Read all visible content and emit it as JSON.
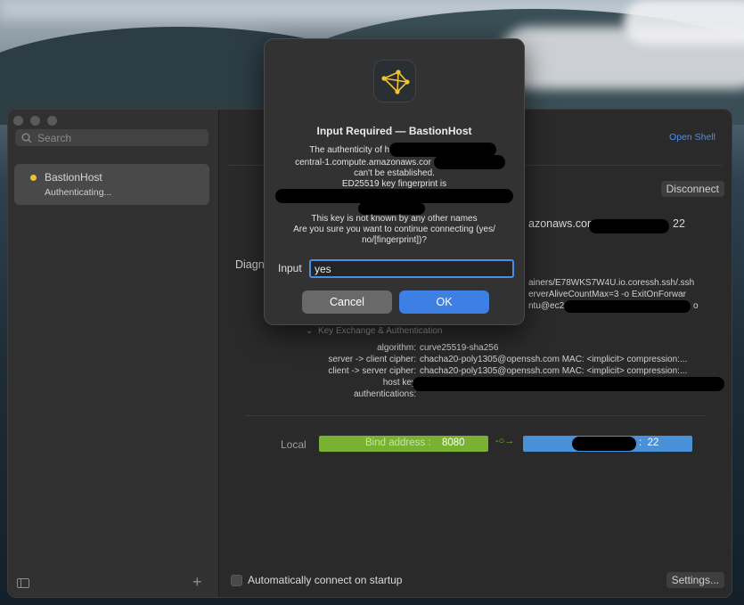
{
  "sidebar": {
    "search_placeholder": "Search",
    "host": {
      "name": "BastionHost",
      "status": "Authenticating..."
    }
  },
  "main": {
    "open_shell": "Open Shell",
    "disconnect": "Disconnect",
    "host_domain_suffix": "azonaws.com",
    "host_port": "22",
    "diagnostics_label": "Diagn",
    "command_lines": [
      "ainers/E78WKS7W4U.io.coressh.ssh/.ssh",
      "erverAliveCountMax=3 -o ExitOnForwar",
      "ntu@ec2"
    ],
    "command_tail": "o",
    "kex": {
      "heading": "Key Exchange & Authentication",
      "rows": [
        {
          "label": "algorithm:",
          "value": "curve25519-sha256"
        },
        {
          "label": "server -> client cipher:",
          "value": "chacha20-poly1305@openssh.com MAC: <implicit> compression:..."
        },
        {
          "label": "client -> server cipher:",
          "value": "chacha20-poly1305@openssh.com MAC: <implicit> compression:..."
        },
        {
          "label": "host key",
          "value": ""
        },
        {
          "label": "authentications:",
          "value": ""
        }
      ]
    },
    "forward": {
      "local_label": "Local",
      "bind_label": "Bind address",
      "bind_sep": ":",
      "bind_port": "8080",
      "dest_sep": ":",
      "dest_port": "22"
    },
    "autoconnect": "Automatically connect on startup",
    "settings": "Settings..."
  },
  "dialog": {
    "title": "Input Required — BastionHost",
    "lines": [
      "The authenticity of hos",
      "central-1.compute.amazonaws.cor",
      "can't be established.",
      "ED25519 key fingerprint is",
      "This key is not known by any other names",
      "Are you sure you want to continue connecting (yes/",
      "no/[fingerprint])?"
    ],
    "input_label": "Input",
    "input_value": "yes",
    "cancel": "Cancel",
    "ok": "OK"
  }
}
